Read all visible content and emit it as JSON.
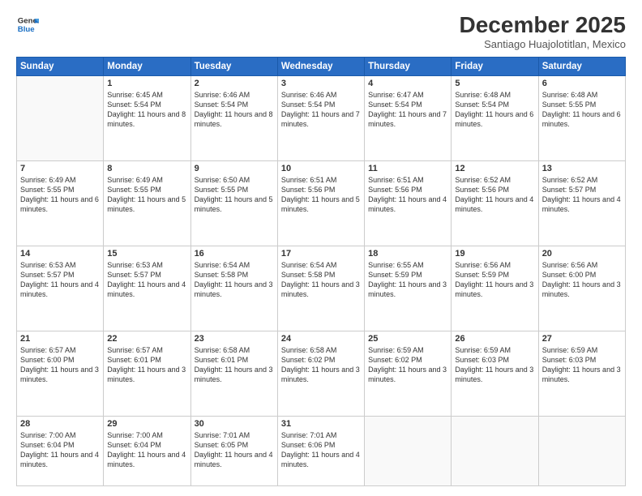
{
  "header": {
    "logo_line1": "General",
    "logo_line2": "Blue",
    "month": "December 2025",
    "location": "Santiago Huajolotitlan, Mexico"
  },
  "weekdays": [
    "Sunday",
    "Monday",
    "Tuesday",
    "Wednesday",
    "Thursday",
    "Friday",
    "Saturday"
  ],
  "weeks": [
    [
      {
        "day": "",
        "sunrise": "",
        "sunset": "",
        "daylight": ""
      },
      {
        "day": "1",
        "sunrise": "Sunrise: 6:45 AM",
        "sunset": "Sunset: 5:54 PM",
        "daylight": "Daylight: 11 hours and 8 minutes."
      },
      {
        "day": "2",
        "sunrise": "Sunrise: 6:46 AM",
        "sunset": "Sunset: 5:54 PM",
        "daylight": "Daylight: 11 hours and 8 minutes."
      },
      {
        "day": "3",
        "sunrise": "Sunrise: 6:46 AM",
        "sunset": "Sunset: 5:54 PM",
        "daylight": "Daylight: 11 hours and 7 minutes."
      },
      {
        "day": "4",
        "sunrise": "Sunrise: 6:47 AM",
        "sunset": "Sunset: 5:54 PM",
        "daylight": "Daylight: 11 hours and 7 minutes."
      },
      {
        "day": "5",
        "sunrise": "Sunrise: 6:48 AM",
        "sunset": "Sunset: 5:54 PM",
        "daylight": "Daylight: 11 hours and 6 minutes."
      },
      {
        "day": "6",
        "sunrise": "Sunrise: 6:48 AM",
        "sunset": "Sunset: 5:55 PM",
        "daylight": "Daylight: 11 hours and 6 minutes."
      }
    ],
    [
      {
        "day": "7",
        "sunrise": "Sunrise: 6:49 AM",
        "sunset": "Sunset: 5:55 PM",
        "daylight": "Daylight: 11 hours and 6 minutes."
      },
      {
        "day": "8",
        "sunrise": "Sunrise: 6:49 AM",
        "sunset": "Sunset: 5:55 PM",
        "daylight": "Daylight: 11 hours and 5 minutes."
      },
      {
        "day": "9",
        "sunrise": "Sunrise: 6:50 AM",
        "sunset": "Sunset: 5:55 PM",
        "daylight": "Daylight: 11 hours and 5 minutes."
      },
      {
        "day": "10",
        "sunrise": "Sunrise: 6:51 AM",
        "sunset": "Sunset: 5:56 PM",
        "daylight": "Daylight: 11 hours and 5 minutes."
      },
      {
        "day": "11",
        "sunrise": "Sunrise: 6:51 AM",
        "sunset": "Sunset: 5:56 PM",
        "daylight": "Daylight: 11 hours and 4 minutes."
      },
      {
        "day": "12",
        "sunrise": "Sunrise: 6:52 AM",
        "sunset": "Sunset: 5:56 PM",
        "daylight": "Daylight: 11 hours and 4 minutes."
      },
      {
        "day": "13",
        "sunrise": "Sunrise: 6:52 AM",
        "sunset": "Sunset: 5:57 PM",
        "daylight": "Daylight: 11 hours and 4 minutes."
      }
    ],
    [
      {
        "day": "14",
        "sunrise": "Sunrise: 6:53 AM",
        "sunset": "Sunset: 5:57 PM",
        "daylight": "Daylight: 11 hours and 4 minutes."
      },
      {
        "day": "15",
        "sunrise": "Sunrise: 6:53 AM",
        "sunset": "Sunset: 5:57 PM",
        "daylight": "Daylight: 11 hours and 4 minutes."
      },
      {
        "day": "16",
        "sunrise": "Sunrise: 6:54 AM",
        "sunset": "Sunset: 5:58 PM",
        "daylight": "Daylight: 11 hours and 3 minutes."
      },
      {
        "day": "17",
        "sunrise": "Sunrise: 6:54 AM",
        "sunset": "Sunset: 5:58 PM",
        "daylight": "Daylight: 11 hours and 3 minutes."
      },
      {
        "day": "18",
        "sunrise": "Sunrise: 6:55 AM",
        "sunset": "Sunset: 5:59 PM",
        "daylight": "Daylight: 11 hours and 3 minutes."
      },
      {
        "day": "19",
        "sunrise": "Sunrise: 6:56 AM",
        "sunset": "Sunset: 5:59 PM",
        "daylight": "Daylight: 11 hours and 3 minutes."
      },
      {
        "day": "20",
        "sunrise": "Sunrise: 6:56 AM",
        "sunset": "Sunset: 6:00 PM",
        "daylight": "Daylight: 11 hours and 3 minutes."
      }
    ],
    [
      {
        "day": "21",
        "sunrise": "Sunrise: 6:57 AM",
        "sunset": "Sunset: 6:00 PM",
        "daylight": "Daylight: 11 hours and 3 minutes."
      },
      {
        "day": "22",
        "sunrise": "Sunrise: 6:57 AM",
        "sunset": "Sunset: 6:01 PM",
        "daylight": "Daylight: 11 hours and 3 minutes."
      },
      {
        "day": "23",
        "sunrise": "Sunrise: 6:58 AM",
        "sunset": "Sunset: 6:01 PM",
        "daylight": "Daylight: 11 hours and 3 minutes."
      },
      {
        "day": "24",
        "sunrise": "Sunrise: 6:58 AM",
        "sunset": "Sunset: 6:02 PM",
        "daylight": "Daylight: 11 hours and 3 minutes."
      },
      {
        "day": "25",
        "sunrise": "Sunrise: 6:59 AM",
        "sunset": "Sunset: 6:02 PM",
        "daylight": "Daylight: 11 hours and 3 minutes."
      },
      {
        "day": "26",
        "sunrise": "Sunrise: 6:59 AM",
        "sunset": "Sunset: 6:03 PM",
        "daylight": "Daylight: 11 hours and 3 minutes."
      },
      {
        "day": "27",
        "sunrise": "Sunrise: 6:59 AM",
        "sunset": "Sunset: 6:03 PM",
        "daylight": "Daylight: 11 hours and 3 minutes."
      }
    ],
    [
      {
        "day": "28",
        "sunrise": "Sunrise: 7:00 AM",
        "sunset": "Sunset: 6:04 PM",
        "daylight": "Daylight: 11 hours and 4 minutes."
      },
      {
        "day": "29",
        "sunrise": "Sunrise: 7:00 AM",
        "sunset": "Sunset: 6:04 PM",
        "daylight": "Daylight: 11 hours and 4 minutes."
      },
      {
        "day": "30",
        "sunrise": "Sunrise: 7:01 AM",
        "sunset": "Sunset: 6:05 PM",
        "daylight": "Daylight: 11 hours and 4 minutes."
      },
      {
        "day": "31",
        "sunrise": "Sunrise: 7:01 AM",
        "sunset": "Sunset: 6:06 PM",
        "daylight": "Daylight: 11 hours and 4 minutes."
      },
      {
        "day": "",
        "sunrise": "",
        "sunset": "",
        "daylight": ""
      },
      {
        "day": "",
        "sunrise": "",
        "sunset": "",
        "daylight": ""
      },
      {
        "day": "",
        "sunrise": "",
        "sunset": "",
        "daylight": ""
      }
    ]
  ]
}
